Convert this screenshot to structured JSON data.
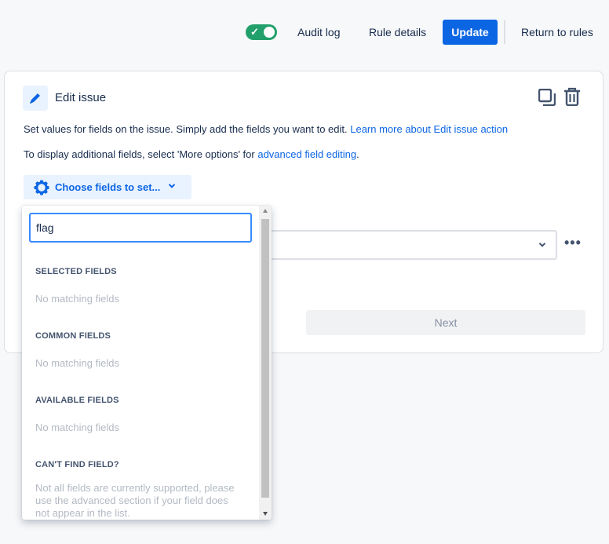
{
  "header": {
    "toggle_state": "on",
    "audit_log": "Audit log",
    "rule_details": "Rule details",
    "update": "Update",
    "return": "Return to rules"
  },
  "card": {
    "title": "Edit issue",
    "desc1_text": "Set values for fields on the issue. Simply add the fields you want to edit. ",
    "desc1_link": "Learn more about Edit issue action",
    "desc2_text": "To display additional fields, select 'More options' for ",
    "desc2_link": "advanced field editing",
    "desc2_end": ".",
    "choose_fields": "Choose fields to set...",
    "next": "Next"
  },
  "dropdown": {
    "search_value": "flag",
    "sections": [
      {
        "heading": "SELECTED FIELDS",
        "empty": "No matching fields"
      },
      {
        "heading": "COMMON FIELDS",
        "empty": "No matching fields"
      },
      {
        "heading": "AVAILABLE FIELDS",
        "empty": "No matching fields"
      },
      {
        "heading": "CAN'T FIND FIELD?",
        "empty": "Not all fields are currently supported, please use the advanced section if your field does not appear in the list."
      }
    ]
  },
  "colors": {
    "accent": "#0c66e4",
    "toggle_on": "#22a06b"
  }
}
